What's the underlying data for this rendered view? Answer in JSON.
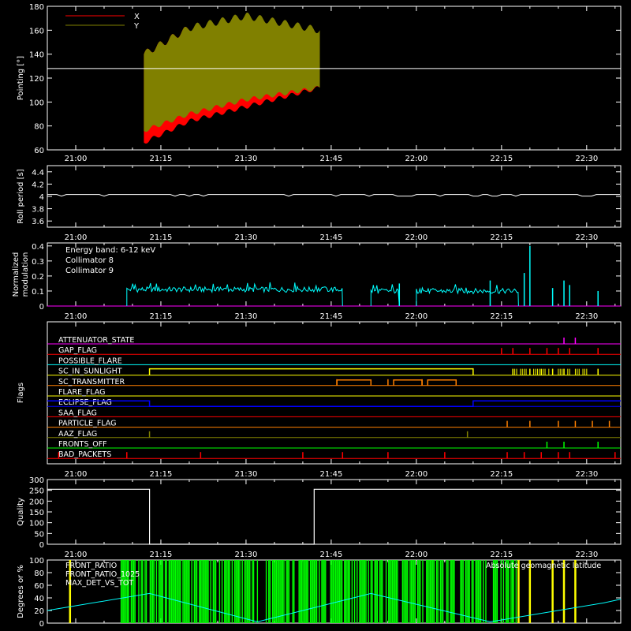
{
  "chart_data": [
    {
      "type": "area",
      "ylabel": "Pointing [°]",
      "ylim": [
        60,
        180
      ],
      "yticks": [
        60,
        80,
        100,
        120,
        140,
        160,
        180
      ],
      "xlim": [
        "20:55",
        "22:36"
      ],
      "xticks": [
        "21:00",
        "21:15",
        "21:30",
        "21:45",
        "22:00",
        "22:15",
        "22:30"
      ],
      "reference_line": 128,
      "legend": [
        {
          "name": "X",
          "color": "#ff0000"
        },
        {
          "name": "Y",
          "color": "#808000"
        }
      ],
      "series": [
        {
          "name": "X",
          "color": "#ff0000",
          "start": "21:12",
          "end": "21:43",
          "upper": [
            {
              "t": "21:12",
              "v": 140
            },
            {
              "t": "21:20",
              "v": 162
            },
            {
              "t": "21:30",
              "v": 166
            },
            {
              "t": "21:43",
              "v": 156
            }
          ],
          "lower": [
            {
              "t": "21:12",
              "v": 66
            },
            {
              "t": "21:20",
              "v": 84
            },
            {
              "t": "21:30",
              "v": 96
            },
            {
              "t": "21:43",
              "v": 112
            }
          ]
        },
        {
          "name": "Y",
          "color": "#808000",
          "start": "21:12",
          "end": "21:43",
          "upper": [
            {
              "t": "21:12",
              "v": 140
            },
            {
              "t": "21:20",
              "v": 162
            },
            {
              "t": "21:30",
              "v": 172
            },
            {
              "t": "21:43",
              "v": 160
            }
          ],
          "lower": [
            {
              "t": "21:12",
              "v": 76
            },
            {
              "t": "21:20",
              "v": 90
            },
            {
              "t": "21:30",
              "v": 102
            },
            {
              "t": "21:43",
              "v": 112
            }
          ]
        }
      ]
    },
    {
      "type": "line",
      "ylabel": "Roll period [s]",
      "ylim": [
        3.5,
        4.5
      ],
      "yticks": [
        3.6,
        3.8,
        4.0,
        4.2,
        4.4
      ],
      "xticks": [
        "21:00",
        "21:15",
        "21:30",
        "21:45",
        "22:00",
        "22:15",
        "22:30"
      ],
      "series": [
        {
          "name": "roll",
          "color": "#ffffff",
          "value": 4.03
        }
      ]
    },
    {
      "type": "line",
      "ylabel": "Normalized modulation",
      "ylim": [
        0,
        0.42
      ],
      "yticks": [
        0,
        0.1,
        0.2,
        0.3,
        0.4
      ],
      "xticks": [
        "21:00",
        "21:15",
        "21:30",
        "21:45",
        "22:00",
        "22:15",
        "22:30"
      ],
      "annotation": "Energy band: 6-12 keV",
      "series": [
        {
          "name": "Collimator 8",
          "color": "#00ffff",
          "segments": [
            [
              "21:09",
              "21:47",
              0.11
            ],
            [
              "21:52",
              "21:57",
              0.1
            ],
            [
              "22:00",
              "22:18",
              0.1
            ]
          ],
          "spikes": [
            {
              "t": "21:57",
              "v": 0.15
            },
            {
              "t": "22:13",
              "v": 0.17
            },
            {
              "t": "22:19",
              "v": 0.22
            },
            {
              "t": "22:20",
              "v": 0.4
            },
            {
              "t": "22:24",
              "v": 0.12
            },
            {
              "t": "22:26",
              "v": 0.17
            },
            {
              "t": "22:27",
              "v": 0.14
            },
            {
              "t": "22:32",
              "v": 0.1
            }
          ]
        },
        {
          "name": "Collimator 9",
          "color": "#ff00ff",
          "value": 0
        }
      ]
    },
    {
      "type": "table",
      "ylabel": "Flags",
      "xticks": [
        "21:00",
        "21:15",
        "21:30",
        "21:45",
        "22:00",
        "22:15",
        "22:30"
      ],
      "flags": [
        {
          "name": "ATTENUATOR_STATE",
          "color": "#ff00ff",
          "events": [
            "22:26",
            "22:28"
          ]
        },
        {
          "name": "GAP_FLAG",
          "color": "#ff0000",
          "events": [
            "22:15",
            "22:17",
            "22:20",
            "22:23",
            "22:25",
            "22:27",
            "22:32"
          ]
        },
        {
          "name": "POSSIBLE_FLARE",
          "color": "#00ffff",
          "events": []
        },
        {
          "name": "SC_IN_SUNLIGHT",
          "color": "#ffff00",
          "events": [
            "22:17",
            "22:20",
            "22:22",
            "22:24",
            "22:26",
            "22:32"
          ]
        },
        {
          "name": "SC_TRANSMITTER",
          "color": "#ff8000",
          "events": [
            "21:46",
            "21:55",
            "22:01"
          ]
        },
        {
          "name": "FLARE_FLAG",
          "color": "#ffff00",
          "events": []
        },
        {
          "name": "ECLIPSE_FLAG",
          "color": "#0000ff",
          "events": []
        },
        {
          "name": "SAA_FLAG",
          "color": "#ff0000",
          "events": []
        },
        {
          "name": "PARTICLE_FLAG",
          "color": "#ff8000",
          "events": [
            "22:16",
            "22:20",
            "22:25",
            "22:28",
            "22:31",
            "22:34"
          ]
        },
        {
          "name": "AAZ_FLAG",
          "color": "#808000",
          "events": [
            "21:13",
            "22:09"
          ]
        },
        {
          "name": "FRONTS_OFF",
          "color": "#00ff00",
          "events": [
            "22:23",
            "22:26",
            "22:32"
          ]
        },
        {
          "name": "BAD_PACKETS",
          "color": "#ff0000",
          "events": [
            "20:57",
            "21:09",
            "21:22",
            "21:40",
            "21:47",
            "21:55",
            "22:05",
            "22:16",
            "22:19",
            "22:22",
            "22:25",
            "22:27",
            "22:35"
          ]
        }
      ]
    },
    {
      "type": "line",
      "ylabel": "Quality",
      "ylim": [
        0,
        300
      ],
      "yticks": [
        0,
        50,
        100,
        150,
        200,
        250,
        300
      ],
      "xticks": [
        "21:00",
        "21:15",
        "21:30",
        "21:45",
        "22:00",
        "22:15",
        "22:30"
      ],
      "series": [
        {
          "name": "quality",
          "color": "#ffffff",
          "points": [
            [
              "20:55",
              255
            ],
            [
              "21:13",
              255
            ],
            [
              "21:13",
              0
            ],
            [
              "21:42",
              0
            ],
            [
              "21:42",
              255
            ],
            [
              "22:36",
              255
            ]
          ]
        }
      ]
    },
    {
      "type": "line",
      "ylabel": "Degrees or %",
      "ylim": [
        0,
        100
      ],
      "yticks": [
        0,
        20,
        40,
        60,
        80,
        100
      ],
      "legend": [
        {
          "name": "FRONT_RATIO",
          "color": "#ffff00"
        },
        {
          "name": "FRONT_RATIO_1025",
          "color": "#00ff00"
        },
        {
          "name": "MAX_DET_VS_TOT",
          "color": "#ff8000"
        }
      ],
      "annotation": "Absolute geomagnetic latitude",
      "series": [
        {
          "name": "Absolute geomagnetic latitude",
          "color": "#00ffff",
          "points": [
            [
              "20:55",
              20
            ],
            [
              "21:13",
              47
            ],
            [
              "21:32",
              2
            ],
            [
              "21:52",
              47
            ],
            [
              "22:13",
              2
            ],
            [
              "22:33",
              32
            ],
            [
              "22:36",
              38
            ]
          ]
        },
        {
          "name": "FRONT_RATIO_1025",
          "color": "#00ff00",
          "start": "21:08",
          "end": "22:18",
          "value": 100
        },
        {
          "name": "FRONT_RATIO",
          "color": "#ffff00",
          "spikes": [
            "20:59",
            "22:18",
            "22:20",
            "22:24",
            "22:26",
            "22:28"
          ]
        }
      ]
    }
  ]
}
